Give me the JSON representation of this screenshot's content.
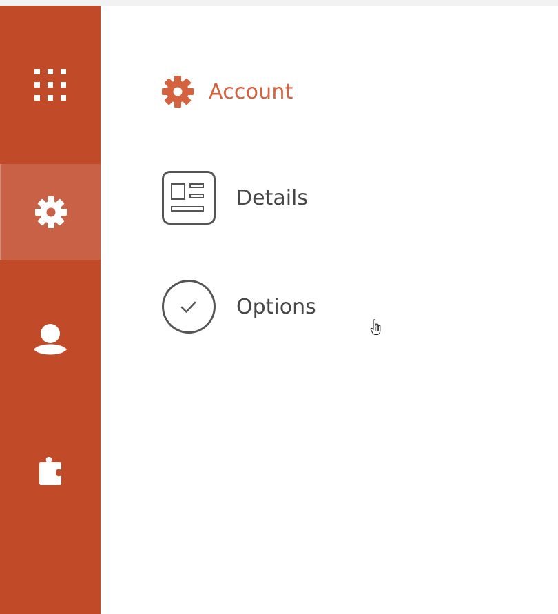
{
  "sidebar": {
    "items": [
      {
        "id": "apps",
        "icon": "grid-icon"
      },
      {
        "id": "settings",
        "icon": "gear-icon",
        "active": true
      },
      {
        "id": "user",
        "icon": "user-icon"
      },
      {
        "id": "plugins",
        "icon": "puzzle-icon"
      }
    ]
  },
  "main": {
    "heading": {
      "icon": "gear-icon",
      "title": "Account"
    },
    "menu": [
      {
        "label": "Details",
        "icon": "details-card-icon"
      },
      {
        "label": "Options",
        "icon": "check-circle-icon"
      }
    ]
  },
  "colors": {
    "sidebar": "#c14a28",
    "sidebar_active": "#c86146",
    "accent": "#d4623f",
    "text": "#474747",
    "icon_stroke": "#555555"
  }
}
